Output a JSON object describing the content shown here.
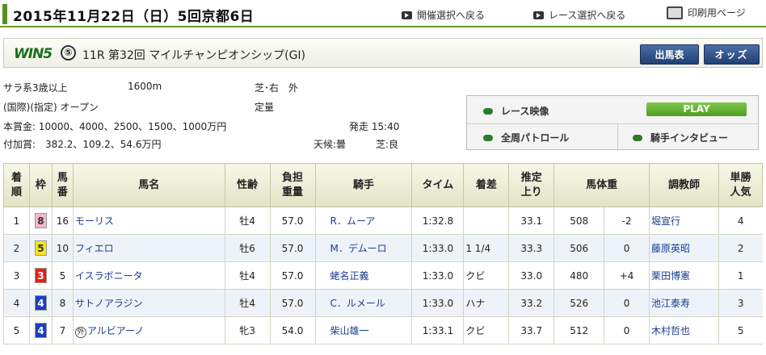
{
  "header": {
    "title": "2015年11月22日（日）5回京都6日",
    "link_meeting": "開催選択へ戻る",
    "link_race": "レース選択へ戻る",
    "link_print": "印刷用ページ"
  },
  "race": {
    "win5_logo": "WIN5",
    "win5_number": "⑤",
    "name": "11R 第32回 マイルチャンピオンシップ(GI)",
    "btn_card": "出馬表",
    "btn_odds": "オッズ"
  },
  "conditions": {
    "class": "サラ系3歳以上",
    "distance": "1600m",
    "course": "芝･右　外",
    "type": "(国際)(指定) オープン",
    "weight_rule": "定量",
    "prize": "本賞金: 10000、4000、2500、1500、1000万円",
    "start": "発走 15:40",
    "addprize": "付加賞:　382.2、109.2、54.6万円",
    "weather": "天候:曇",
    "going": "芝:良"
  },
  "video": {
    "race_video": "レース映像",
    "play": "PLAY",
    "patrol": "全周パトロール",
    "interview": "騎手インタビュー"
  },
  "table": {
    "headers": {
      "rank": "着順",
      "frame": "枠",
      "num": "馬番",
      "horse": "馬名",
      "sexage": "性齢",
      "weight": "負担重量",
      "jockey": "騎手",
      "time": "タイム",
      "margin": "着差",
      "last3f": "推定上り",
      "bodyweight": "馬体重",
      "trainer": "調教師",
      "pop": "単勝人気"
    },
    "rows": [
      {
        "rank": "1",
        "frame": "8",
        "frame_color": "#f8b6c8",
        "frame_text": "#333",
        "num": "16",
        "prefix": "",
        "horse": "モーリス",
        "sexage": "牡4",
        "weight": "57.0",
        "jockey": "R．ムーア",
        "time": "1:32.8",
        "margin": "",
        "last3f": "33.1",
        "bw": "508",
        "bwd": "-2",
        "trainer": "堀宣行",
        "pop": "4"
      },
      {
        "rank": "2",
        "frame": "5",
        "frame_color": "#f7e31c",
        "frame_text": "#333",
        "num": "10",
        "prefix": "",
        "horse": "フィエロ",
        "sexage": "牡6",
        "weight": "57.0",
        "jockey": "M．デムーロ",
        "time": "1:33.0",
        "margin": "1 1/4",
        "last3f": "33.3",
        "bw": "506",
        "bwd": "0",
        "trainer": "藤原英昭",
        "pop": "2"
      },
      {
        "rank": "3",
        "frame": "3",
        "frame_color": "#e8201c",
        "frame_text": "#fff",
        "num": "5",
        "prefix": "",
        "horse": "イスラボニータ",
        "sexage": "牡4",
        "weight": "57.0",
        "jockey": "蛯名正義",
        "time": "1:33.0",
        "margin": "クビ",
        "last3f": "33.0",
        "bw": "480",
        "bwd": "+4",
        "trainer": "栗田博憲",
        "pop": "1"
      },
      {
        "rank": "4",
        "frame": "4",
        "frame_color": "#1b3fc2",
        "frame_text": "#fff",
        "num": "8",
        "prefix": "",
        "horse": "サトノアラジン",
        "sexage": "牡4",
        "weight": "57.0",
        "jockey": "C．ルメール",
        "time": "1:33.0",
        "margin": "ハナ",
        "last3f": "33.2",
        "bw": "526",
        "bwd": "0",
        "trainer": "池江泰寿",
        "pop": "3"
      },
      {
        "rank": "5",
        "frame": "4",
        "frame_color": "#1b3fc2",
        "frame_text": "#fff",
        "num": "7",
        "prefix": "外",
        "horse": "アルビアーノ",
        "sexage": "牝3",
        "weight": "54.0",
        "jockey": "柴山雄一",
        "time": "1:33.1",
        "margin": "クビ",
        "last3f": "33.7",
        "bw": "512",
        "bwd": "0",
        "trainer": "木村哲也",
        "pop": "5"
      }
    ]
  }
}
